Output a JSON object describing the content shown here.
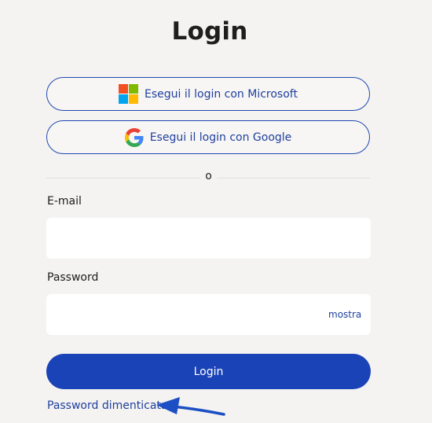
{
  "page": {
    "title": "Login"
  },
  "sso": {
    "microsoft_label": "Esegui il login con Microsoft",
    "google_label": "Esegui il login con Google"
  },
  "divider": {
    "text": "o"
  },
  "form": {
    "email_label": "E-mail",
    "email_value": "",
    "password_label": "Password",
    "password_value": "",
    "show_label": "mostra",
    "submit_label": "Login",
    "forgot_label": "Password dimenticata?"
  },
  "colors": {
    "accent": "#1b43b8",
    "link": "#1f3f9f",
    "background": "#f4f3f1",
    "annotation_arrow": "#1d4fc4"
  },
  "icons": {
    "microsoft": "microsoft-logo-icon",
    "google": "google-logo-icon",
    "annotation": "arrow-left-icon"
  }
}
